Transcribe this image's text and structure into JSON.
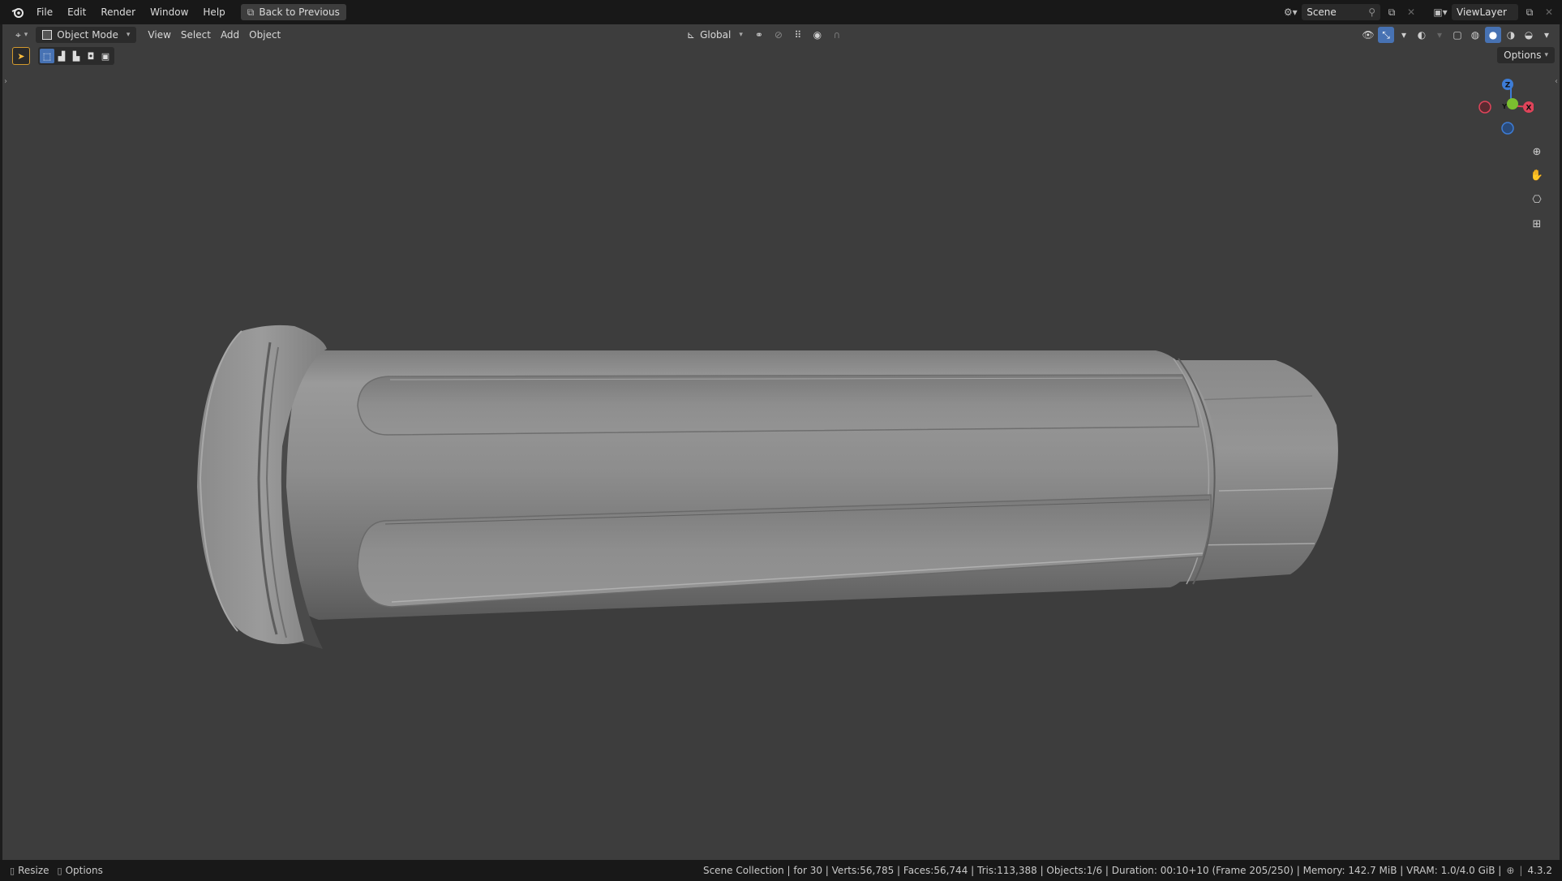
{
  "topbar": {
    "menu": [
      "File",
      "Edit",
      "Render",
      "Window",
      "Help"
    ],
    "back_label": "Back to Previous",
    "scene_label": "Scene",
    "viewlayer_label": "ViewLayer"
  },
  "viewport_header": {
    "mode_label": "Object Mode",
    "menu": [
      "View",
      "Select",
      "Add",
      "Object"
    ],
    "transform_orientation": "Global",
    "options_label": "Options"
  },
  "gizmo": {
    "z": "Z",
    "x": "X",
    "y": "Y"
  },
  "statusbar": {
    "left": [
      "Resize",
      "Options"
    ],
    "right": "Scene Collection | for 30 | Verts:56,785 | Faces:56,744 | Tris:113,388 | Objects:1/6 | Duration: 00:10+10 (Frame 205/250) | Memory: 142.7 MiB | VRAM: 1.0/4.0 GiB |",
    "version": "4.3.2"
  },
  "colors": {
    "accent": "#4772b3",
    "viewport_bg": "#3d3d3d",
    "axis_x": "#e0445a",
    "axis_y": "#7bc02f",
    "axis_z": "#3d7cd6"
  }
}
